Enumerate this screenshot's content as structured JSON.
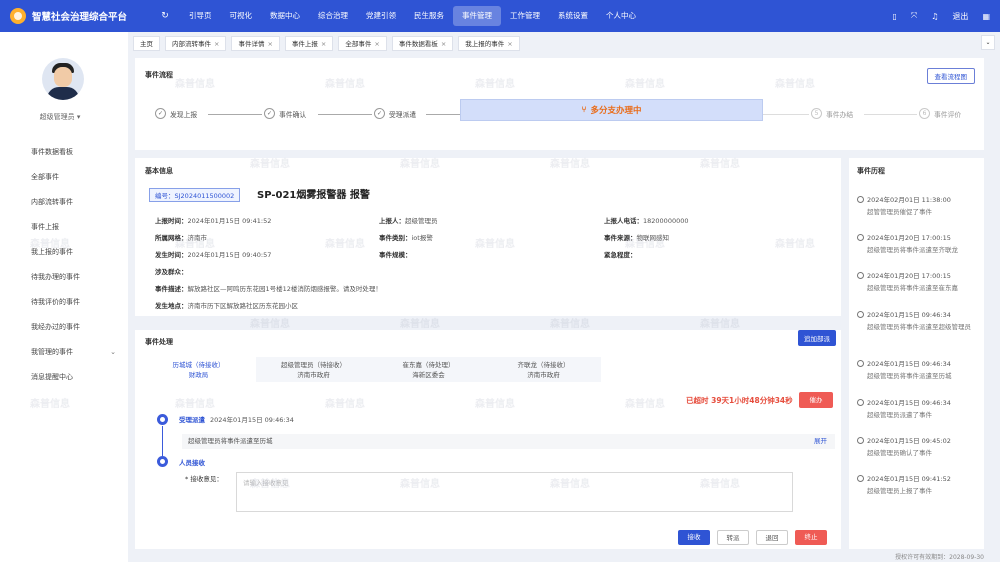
{
  "app": {
    "title": "智慧社会治理综合平台"
  },
  "topnav": [
    "引导页",
    "可视化",
    "数据中心",
    "综合治理",
    "党建引领",
    "民生服务",
    "事件管理",
    "工作管理",
    "系统设置",
    "个人中心"
  ],
  "topright": {
    "exit_label": "退出"
  },
  "sidebar": {
    "user_name": "超级管理员",
    "items": [
      {
        "label": "事件数据看板"
      },
      {
        "label": "全部事件"
      },
      {
        "label": "内部流转事件"
      },
      {
        "label": "事件上报"
      },
      {
        "label": "我上报的事件"
      },
      {
        "label": "待我办理的事件"
      },
      {
        "label": "待我评价的事件"
      },
      {
        "label": "我经办过的事件"
      },
      {
        "label": "我管理的事件"
      },
      {
        "label": "消息提醒中心"
      }
    ]
  },
  "tabs": [
    "主页",
    "内部流转事件",
    "事件详情",
    "事件上报",
    "全部事件",
    "事件数据看板",
    "我上报的事件"
  ],
  "flow": {
    "title": "事件流程",
    "view_button": "查看流程图",
    "steps": [
      {
        "label": "发现上报",
        "icon": "✓"
      },
      {
        "label": "事件确认",
        "icon": "✓"
      },
      {
        "label": "受理派遣",
        "icon": "✓"
      },
      {
        "label": "多分支办理中",
        "icon": "⑂"
      },
      {
        "label": "事件办结",
        "icon": "5"
      },
      {
        "label": "事件评价",
        "icon": "6"
      }
    ]
  },
  "info": {
    "title": "基本信息",
    "code": "编号：SJ2024011500002",
    "name": "SP-021烟雾报警器 报警",
    "fields": {
      "report_time": {
        "label": "上报时间：",
        "value": "2024年01月15日 09:41:52"
      },
      "reporter": {
        "label": "上报人：",
        "value": "超级管理员"
      },
      "reporter_phone": {
        "label": "上报人电话：",
        "value": "18200000000"
      },
      "grid": {
        "label": "所属网格：",
        "value": "济南市"
      },
      "category": {
        "label": "事件类别：",
        "value": "iot报警"
      },
      "source": {
        "label": "事件来源：",
        "value": "物联网感知"
      },
      "occur_time": {
        "label": "发生时间：",
        "value": "2024年01月15日 09:40:57"
      },
      "scale": {
        "label": "事件规模：",
        "value": ""
      },
      "urgency": {
        "label": "紧急程度：",
        "value": ""
      },
      "persons": {
        "label": "涉及群众：",
        "value": ""
      },
      "desc": {
        "label": "事件描述：",
        "value": "解放路社区—阿鸣历东花园1号楼12楼消防烟感报警。请及时处理！"
      },
      "location": {
        "label": "发生地点：",
        "value": "济南市历下区解放路社区历东花园小区"
      }
    }
  },
  "handling": {
    "title": "事件处理",
    "add_dept": "追加部派",
    "depts": [
      {
        "name": "历城城（待接收）",
        "org": "财政局"
      },
      {
        "name": "超级管理员（待接收）",
        "org": "济南市政府"
      },
      {
        "name": "崔东嘉（待处理）",
        "org": "海新区委会"
      },
      {
        "name": "齐联龙（待接收）",
        "org": "济南市政府"
      }
    ],
    "overtime": "已超时 39天1小时48分钟34秒",
    "urge": "催办",
    "step1": {
      "title": "受理派遣",
      "time": "2024年01月15日 09:46:34",
      "note": "超级管理员将事件派遣至历城",
      "expand": "展开"
    },
    "step2": {
      "title": "人员接收"
    },
    "opinion_label": "* 接收意见：",
    "opinion_placeholder": "请输入接收意见",
    "buttons": {
      "accept": "接收",
      "transfer": "转派",
      "back": "退回",
      "stop": "终止"
    }
  },
  "history": {
    "title": "事件历程",
    "items": [
      {
        "time": "2024年02月01日 11:38:00",
        "desc": "超管管理员催促了事件"
      },
      {
        "time": "2024年01月20日 17:00:15",
        "desc": "超级管理员将事件派遣至齐联龙"
      },
      {
        "time": "2024年01月20日 17:00:15",
        "desc": "超级管理员将事件派遣至崔东嘉"
      },
      {
        "time": "2024年01月15日 09:46:34",
        "desc": "超级管理员将事件派遣至超级管理员"
      },
      {
        "time": "2024年01月15日 09:46:34",
        "desc": "超级管理员将事件派遣至历城"
      },
      {
        "time": "2024年01月15日 09:46:34",
        "desc": "超级管理员派遣了事件"
      },
      {
        "time": "2024年01月15日 09:45:02",
        "desc": "超级管理员确认了事件"
      },
      {
        "time": "2024年01月15日 09:41:52",
        "desc": "超级管理员上报了事件"
      }
    ]
  },
  "footer": {
    "text": "授权许可有效期到：2028-09-30"
  },
  "watermark": "森普信息"
}
